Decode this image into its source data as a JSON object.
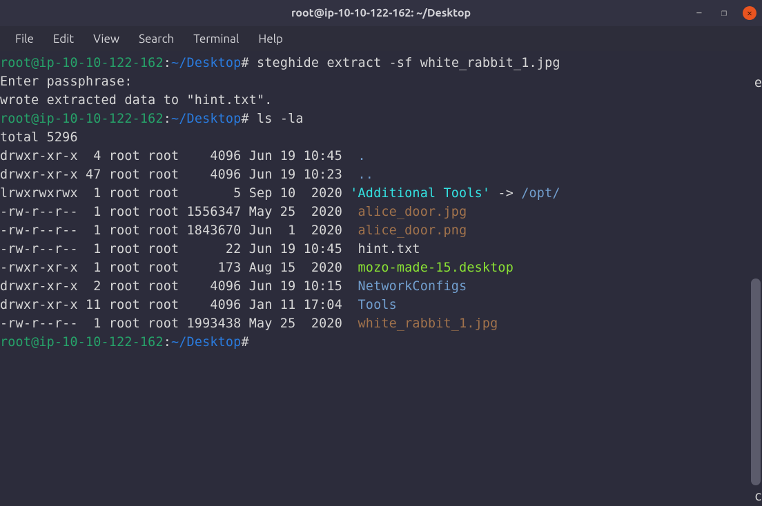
{
  "titlebar": {
    "title": "root@ip-10-10-122-162: ~/Desktop",
    "minimize": "−",
    "restore": "❐",
    "close": "✕"
  },
  "menubar": {
    "items": [
      "File",
      "Edit",
      "View",
      "Search",
      "Terminal",
      "Help"
    ]
  },
  "prompt": {
    "user": "root@ip-10-10-122-162",
    "colon": ":",
    "path": "~/Desktop",
    "sigil": "#"
  },
  "cmd1": "steghide extract -sf white_rabbit_1.jpg",
  "out1_l1": "Enter passphrase:",
  "out1_l2": "wrote extracted data to \"hint.txt\".",
  "cmd2": "ls -la",
  "ls_total": "total 5296",
  "ls_rows": [
    {
      "perm": "drwxr-xr-x  4 root root    4096 Jun 19 10:45  ",
      "name": ".",
      "cls": "dir-color",
      "suffix": ""
    },
    {
      "perm": "drwxr-xr-x 47 root root    4096 Jun 19 10:23  ",
      "name": "..",
      "cls": "dir-color",
      "suffix": ""
    },
    {
      "perm": "lrwxrwxrwx  1 root root       5 Sep 10  2020 ",
      "name": "'Additional Tools'",
      "cls": "link-color",
      "suffix": " -> ",
      "target": "/opt/"
    },
    {
      "perm": "-rw-r--r--  1 root root 1556347 May 25  2020  ",
      "name": "alice_door.jpg",
      "cls": "img-color",
      "suffix": ""
    },
    {
      "perm": "-rw-r--r--  1 root root 1843670 Jun  1  2020  ",
      "name": "alice_door.png",
      "cls": "img-color",
      "suffix": ""
    },
    {
      "perm": "-rw-r--r--  1 root root      22 Jun 19 10:45  ",
      "name": "hint.txt",
      "cls": "plain",
      "suffix": ""
    },
    {
      "perm": "-rwxr-xr-x  1 root root     173 Aug 15  2020  ",
      "name": "mozo-made-15.desktop",
      "cls": "exec-color",
      "suffix": ""
    },
    {
      "perm": "drwxr-xr-x  2 root root    4096 Jun 19 10:15  ",
      "name": "NetworkConfigs",
      "cls": "dir-color",
      "suffix": ""
    },
    {
      "perm": "drwxr-xr-x 11 root root    4096 Jan 11 17:04  ",
      "name": "Tools",
      "cls": "dir-color",
      "suffix": ""
    },
    {
      "perm": "-rw-r--r--  1 root root 1993438 May 25  2020  ",
      "name": "white_rabbit_1.jpg",
      "cls": "img-color",
      "suffix": ""
    }
  ],
  "edge": {
    "l1": "e",
    "l2": "c"
  }
}
